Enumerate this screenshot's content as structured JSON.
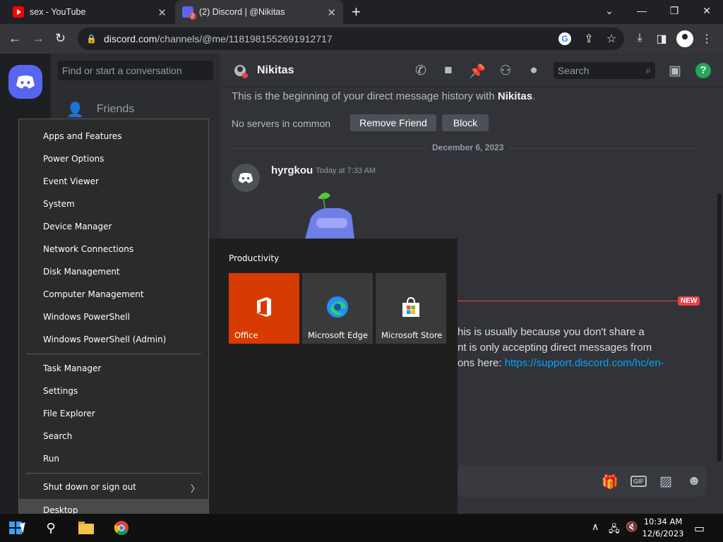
{
  "browser": {
    "tabs": [
      {
        "title": "sex - YouTube",
        "favicon": "youtube-icon"
      },
      {
        "title": "(2) Discord | @Nikitas",
        "favicon": "discord-icon",
        "badge": "2"
      }
    ],
    "url_host": "discord.com",
    "url_path": "/channels/@me/1181981552691912717"
  },
  "discord": {
    "search_placeholder": "Find or start a conversation",
    "friends_label": "Friends",
    "dm_user": "Nikitas",
    "header_search": "Search",
    "help_label": "?",
    "beginning_text_pre": "This is the beginning of your direct message history with ",
    "beginning_text_user": "Nikitas",
    "beginning_text_post": ".",
    "no_servers": "No servers in common",
    "remove_friend": "Remove Friend",
    "block": "Block",
    "date_divider": "December 6, 2023",
    "message": {
      "author": "hyrgkou",
      "time": "Today at 7:33 AM"
    },
    "new_tag": "NEW",
    "system_lines": [
      "his is usually because you don't share a",
      "nt is only accepting direct messages from"
    ],
    "system_line3_pre": "ons here: ",
    "system_link": "https://support.discord.com/hc/en-",
    "composer_gif": "GIF"
  },
  "winx_menu": {
    "group1": [
      "Apps and Features",
      "Power Options",
      "Event Viewer",
      "System",
      "Device Manager",
      "Network Connections",
      "Disk Management",
      "Computer Management",
      "Windows PowerShell",
      "Windows PowerShell (Admin)"
    ],
    "group2": [
      "Task Manager",
      "Settings",
      "File Explorer",
      "Search",
      "Run"
    ],
    "shutdown": "Shut down or sign out",
    "desktop": "Desktop"
  },
  "start_menu": {
    "group_title": "Productivity",
    "tiles": [
      {
        "label": "Office",
        "color": "#d83b01"
      },
      {
        "label": "Microsoft Edge",
        "color": "#3a3a3a"
      },
      {
        "label": "Microsoft Store",
        "color": "#3a3a3a"
      }
    ]
  },
  "taskbar": {
    "time": "10:34 AM",
    "date": "12/6/2023"
  },
  "colors": {
    "discord_blurple": "#5865f2",
    "office_orange": "#d83b01",
    "link_blue": "#00a8fc",
    "new_red": "#f23f42"
  }
}
